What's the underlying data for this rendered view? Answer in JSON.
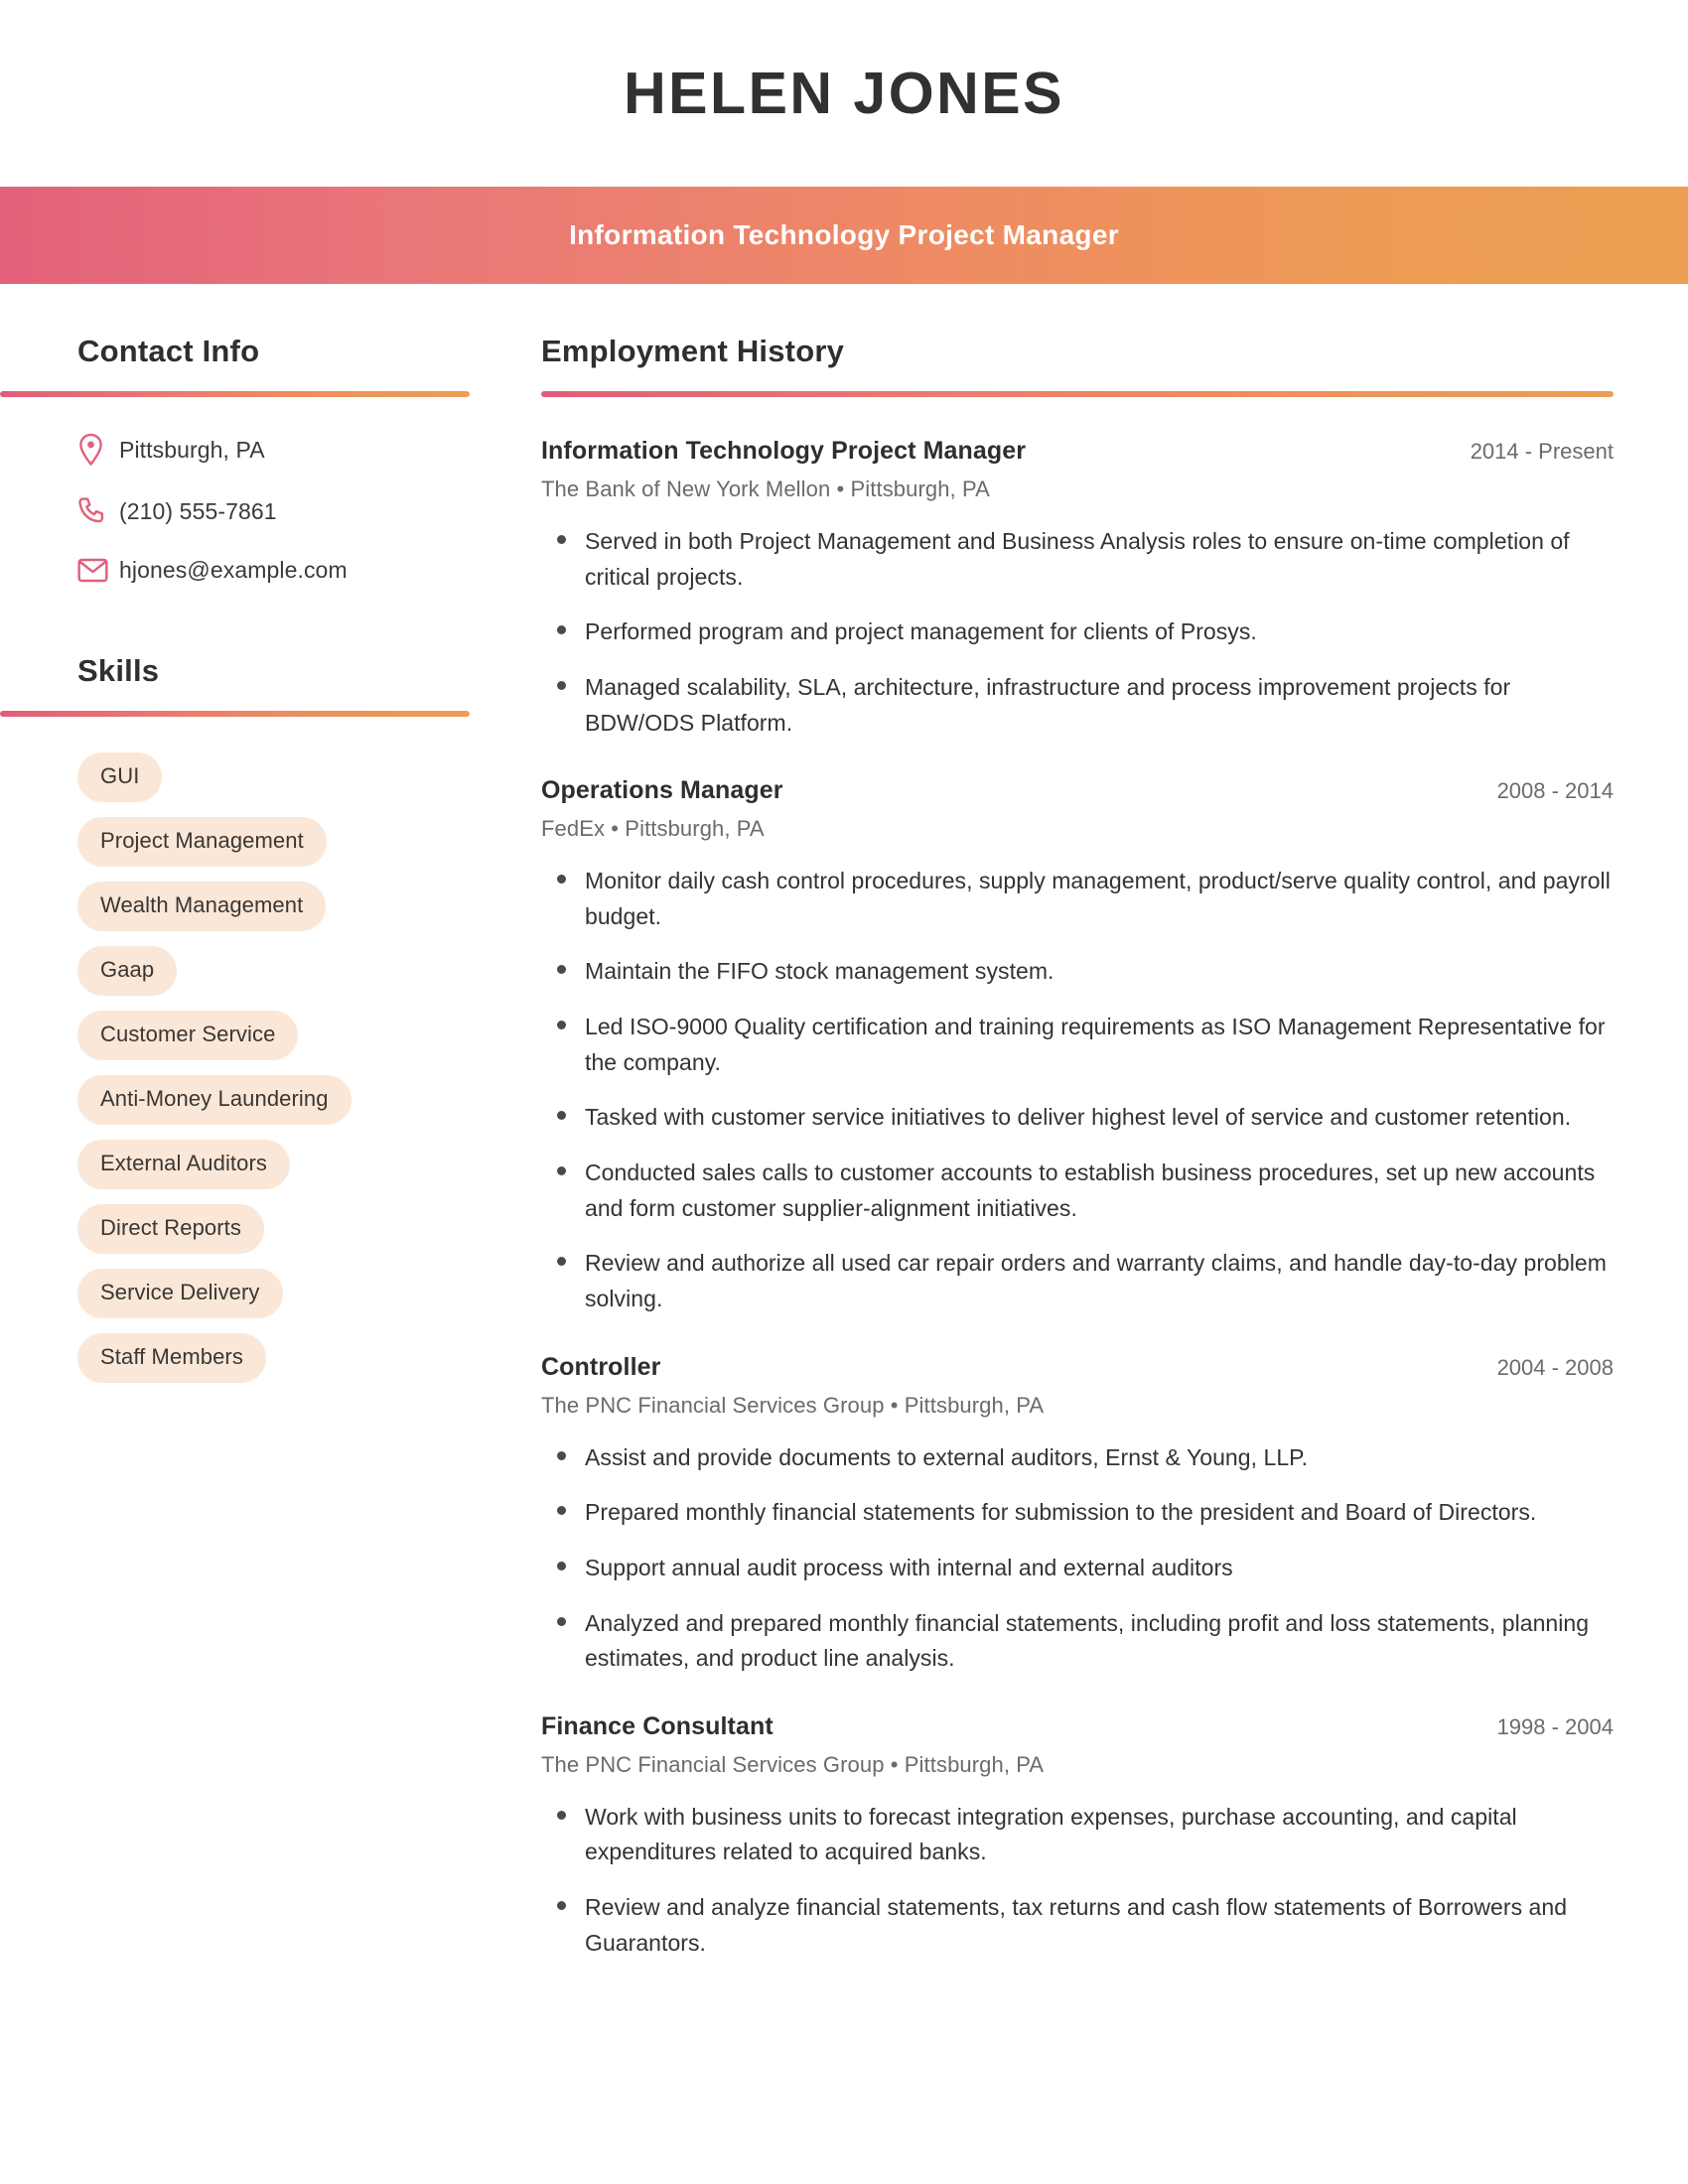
{
  "header": {
    "full_name": "HELEN JONES",
    "job_title": "Information Technology Project Manager",
    "gradient_start": "#E36179",
    "gradient_end": "#EC9F52"
  },
  "sidebar": {
    "contact": {
      "heading": "Contact Info",
      "items": [
        {
          "icon": "location-pin-icon",
          "value": "Pittsburgh, PA"
        },
        {
          "icon": "phone-icon",
          "value": "(210) 555-7861"
        },
        {
          "icon": "envelope-icon",
          "value": "hjones@example.com"
        }
      ]
    },
    "skills": {
      "heading": "Skills",
      "pill_color": "#FAE7D7",
      "items": [
        "GUI",
        "Project Management",
        "Wealth Management",
        "Gaap",
        "Customer Service",
        "Anti-Money Laundering",
        "External Auditors",
        "Direct Reports",
        "Service Delivery",
        "Staff Members"
      ]
    }
  },
  "main": {
    "employment": {
      "heading": "Employment History",
      "jobs": [
        {
          "role": "Information Technology Project Manager",
          "dates": "2014 - Present",
          "meta": "The Bank of New York Mellon  •  Pittsburgh, PA",
          "bullets": [
            "Served in both Project Management and Business Analysis roles to ensure on-time completion of critical projects.",
            "Performed program and project management for clients of Prosys.",
            "Managed scalability, SLA, architecture, infrastructure and process improvement projects for BDW/ODS Platform."
          ]
        },
        {
          "role": "Operations Manager",
          "dates": "2008 - 2014",
          "meta": "FedEx  •  Pittsburgh, PA",
          "bullets": [
            "Monitor daily cash control procedures, supply management, product/serve quality control, and payroll budget.",
            "Maintain the FIFO stock management system.",
            "Led ISO-9000 Quality certification and training requirements as ISO Management Representative for the company.",
            "Tasked with customer service initiatives to deliver highest level of service and customer retention.",
            "Conducted sales calls to customer accounts to establish business procedures, set up new accounts and form customer supplier-alignment initiatives.",
            "Review and authorize all used car repair orders and warranty claims, and handle day-to-day problem solving."
          ]
        },
        {
          "role": "Controller",
          "dates": "2004 - 2008",
          "meta": "The PNC Financial Services Group  •  Pittsburgh, PA",
          "bullets": [
            "Assist and provide documents to external auditors, Ernst & Young, LLP.",
            "Prepared monthly financial statements for submission to the president and Board of Directors.",
            "Support annual audit process with internal and external auditors",
            "Analyzed and prepared monthly financial statements, including profit and loss statements, planning estimates, and product line analysis."
          ]
        },
        {
          "role": "Finance Consultant",
          "dates": "1998 - 2004",
          "meta": "The PNC Financial Services Group  •  Pittsburgh, PA",
          "bullets": [
            "Work with business units to forecast integration expenses, purchase accounting, and capital expenditures related to acquired banks.",
            "Review and analyze financial statements, tax returns and cash flow statements of Borrowers and Guarantors."
          ]
        }
      ]
    }
  }
}
